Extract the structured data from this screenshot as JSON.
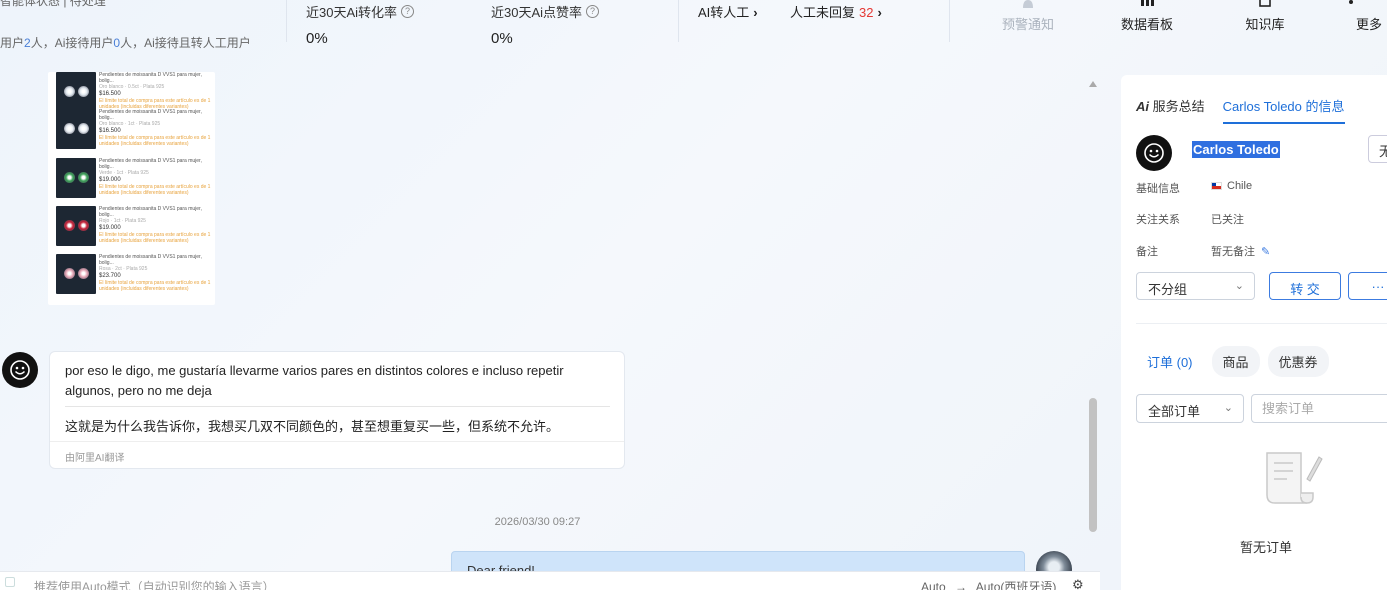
{
  "topbar": {
    "left_top_text": "智能体状态 | 待处理",
    "left_text_parts": [
      "用户",
      "2",
      "人，Ai接待用户",
      "0",
      "人，Ai接待且转人工用户"
    ],
    "stats": [
      {
        "label": "近30天Ai转化率",
        "value": "0%"
      },
      {
        "label": "近30天Ai点赞率",
        "value": "0%"
      }
    ],
    "ai_transfer_label": "AI转人工",
    "unreplied_label": "人工未回复",
    "unreplied_count": "32",
    "tools": [
      {
        "label": "预警通知",
        "icon": "bell-icon",
        "disabled": true
      },
      {
        "label": "数据看板",
        "icon": "chart-icon",
        "disabled": false
      },
      {
        "label": "知识库",
        "icon": "book-icon",
        "disabled": false
      },
      {
        "label": "更多",
        "icon": "more-icon",
        "disabled": false
      }
    ]
  },
  "chat": {
    "products": [
      {
        "title": "Pendientes de moissanita D VVS1 para mujer, bolig...",
        "subtitle": "Oro blanco · 0.5ct · Plata 925",
        "price": "$16.500",
        "note": "El límite total de compra para este artículo es de 1 unidades (incluidas diferentes variantes)",
        "gem": "#dfe7ee"
      },
      {
        "title": "Pendientes de moissanita D VVS1 para mujer, bolig...",
        "subtitle": "Oro blanco · 1ct · Plata 925",
        "price": "$16.500",
        "note": "El límite total de compra para este artículo es de 1 unidades (incluidas diferentes variantes)",
        "gem": "#e6ecf2"
      },
      {
        "title": "Pendientes de moissanita D VVS1 para mujer, bolig...",
        "subtitle": "Verde · 1ct · Plata 925",
        "price": "$19.000",
        "note": "El límite total de compra para este artículo es de 1 unidades (incluidas diferentes variantes)",
        "gem": "#3fa45b"
      },
      {
        "title": "Pendientes de moissanita D VVS1 para mujer, bolig...",
        "subtitle": "Rojo · 1ct · Plata 925",
        "price": "$19.000",
        "note": "El límite total de compra para este artículo es de 1 unidades (incluidas diferentes variantes)",
        "gem": "#c8243a"
      },
      {
        "title": "Pendientes de moissanita D VVS1 para mujer, bolig...",
        "subtitle": "Rosa · 2ct · Plata 925",
        "price": "$23.700",
        "note": "El límite total de compra para este artículo es de 1 unidades (incluidas diferentes variantes)",
        "gem": "#e7a9b8"
      }
    ],
    "message_original": "por eso le digo, me gustaría llevarme varios pares en distintos colores e incluso repetir algunos, pero no me deja",
    "message_translation": "这就是为什么我告诉你，我想买几双不同颜色的，甚至想重复买一些，但系统不允许。",
    "translation_footer": "由阿里AI翻译",
    "timestamp": "2026/03/30 09:27",
    "reply_preview": "Dear friend!"
  },
  "input": {
    "placeholder": "推荐使用Auto模式（自动识别您的输入语言）",
    "lang_from": "Auto",
    "lang_arrow": "→",
    "lang_to": "Auto(西班牙语)"
  },
  "panel": {
    "tab_summary_ai": "Ai",
    "tab_summary": "服务总结",
    "tab_info": "Carlos Toledo 的信息",
    "name": "Carlos Toledo",
    "edge_button": "无",
    "rows": [
      {
        "label": "基础信息",
        "value": "Chile"
      },
      {
        "label": "关注关系",
        "value": "已关注"
      },
      {
        "label": "备注",
        "value": "暂无备注"
      }
    ],
    "group_select": "不分组",
    "transfer_button": "转 交",
    "more_button": "···",
    "order_tabs": [
      "订单 (0)",
      "商品",
      "优惠券"
    ],
    "order_filter": "全部订单",
    "order_search_placeholder": "搜索订单",
    "empty_text": "暂无订单"
  },
  "colors": {
    "accent": "#1e6fd9",
    "alert": "#e53935"
  }
}
